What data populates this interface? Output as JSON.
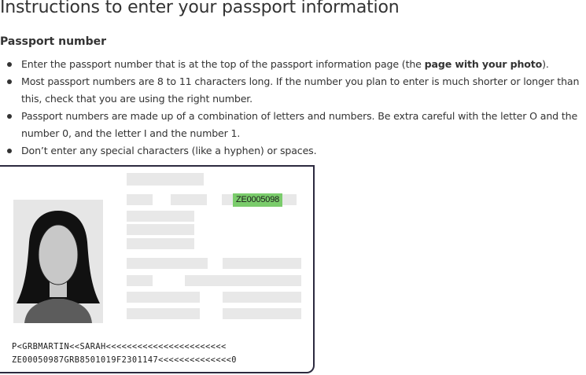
{
  "page": {
    "title": "Instructions to enter your passport information",
    "section_title": "Passport number",
    "bullets": {
      "b1_pre": "Enter the passport number that is at the top of the passport information page (the ",
      "b1_bold": "page with your photo",
      "b1_post": ").",
      "b2": "Most passport numbers are 8 to 11 characters long. If the number you plan to enter is much shorter or longer than this, check that you are using the right number.",
      "b3": "Passport numbers are made up of a combination of letters and numbers. Be extra careful with the letter O and the number 0, and the letter I and the number 1.",
      "b4": "Don’t enter any special characters (like a hyphen) or spaces."
    }
  },
  "passport": {
    "number": "ZE0005098",
    "number_highlight_color": "#7acc6b",
    "border_color": "#2c2a3f",
    "mrz_line1": "P<GRBMARTIN<<SARAH<<<<<<<<<<<<<<<<<<<<<<<",
    "mrz_line2": "ZE00050987GRB8501019F2301147<<<<<<<<<<<<<<0"
  }
}
